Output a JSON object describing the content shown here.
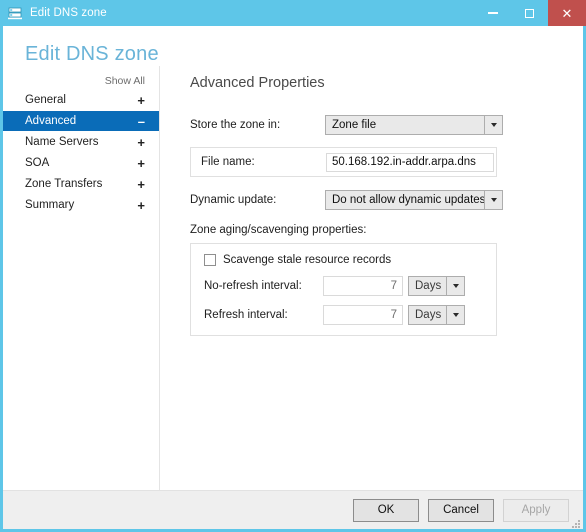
{
  "window": {
    "title": "Edit DNS zone",
    "icon": "dns-zone-icon",
    "accent_color": "#5ec6e8",
    "buttons": {
      "minimize": "minimize",
      "maximize": "maximize",
      "close": "close"
    }
  },
  "page": {
    "heading": "Edit DNS zone",
    "heading_color": "#6ab4d8"
  },
  "nav": {
    "show_all": "Show All",
    "selected_color": "#0a6cb8",
    "items": [
      {
        "label": "General",
        "expander": "+",
        "selected": false
      },
      {
        "label": "Advanced",
        "expander": "–",
        "selected": true
      },
      {
        "label": "Name Servers",
        "expander": "+",
        "selected": false
      },
      {
        "label": "SOA",
        "expander": "+",
        "selected": false
      },
      {
        "label": "Zone Transfers",
        "expander": "+",
        "selected": false
      },
      {
        "label": "Summary",
        "expander": "+",
        "selected": false
      }
    ]
  },
  "content": {
    "section_title": "Advanced Properties",
    "store_zone": {
      "label": "Store the zone in:",
      "value": "Zone file"
    },
    "file_name": {
      "label": "File name:",
      "value": "50.168.192.in-addr.arpa.dns"
    },
    "dynamic_update": {
      "label": "Dynamic update:",
      "value": "Do not allow dynamic updates"
    },
    "aging": {
      "caption": "Zone aging/scavenging properties:",
      "scavenge": {
        "label": "Scavenge stale resource records",
        "checked": false
      },
      "no_refresh": {
        "label": "No-refresh interval:",
        "value": "7",
        "units": "Days"
      },
      "refresh": {
        "label": "Refresh interval:",
        "value": "7",
        "units": "Days"
      }
    }
  },
  "footer": {
    "ok": "OK",
    "cancel": "Cancel",
    "apply": "Apply"
  }
}
